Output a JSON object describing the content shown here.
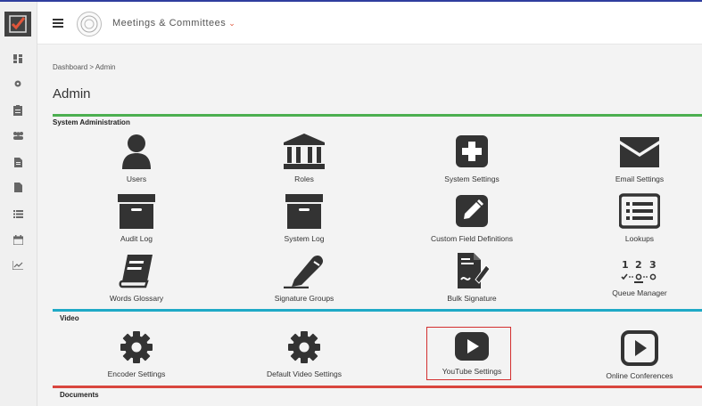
{
  "header": {
    "app_title": "Meetings & Committees",
    "title_chevron": "⌄"
  },
  "sidebar": {
    "items": [
      {
        "icon": "dashboard-icon"
      },
      {
        "icon": "gear-icon"
      },
      {
        "icon": "clipboard-icon"
      },
      {
        "icon": "users-icon"
      },
      {
        "icon": "document-icon"
      },
      {
        "icon": "file-icon"
      },
      {
        "icon": "list-icon"
      },
      {
        "icon": "calendar-icon"
      },
      {
        "icon": "chart-icon"
      }
    ]
  },
  "breadcrumb": {
    "root": "Dashboard",
    "separator": ">",
    "current": "Admin"
  },
  "page_title": "Admin",
  "sections": {
    "system": {
      "label": "System Administration",
      "color": "#4caf50",
      "tiles": [
        {
          "label": "Users",
          "icon": "user-icon"
        },
        {
          "label": "Roles",
          "icon": "institution-icon"
        },
        {
          "label": "System Settings",
          "icon": "plus-square-icon"
        },
        {
          "label": "Email Settings",
          "icon": "envelope-icon"
        },
        {
          "label": "Audit Log",
          "icon": "archive-icon"
        },
        {
          "label": "System Log",
          "icon": "archive-icon"
        },
        {
          "label": "Custom Field Definitions",
          "icon": "edit-square-icon"
        },
        {
          "label": "Lookups",
          "icon": "list-alt-icon"
        },
        {
          "label": "Words Glossary",
          "icon": "book-icon"
        },
        {
          "label": "Signature Groups",
          "icon": "pen-icon"
        },
        {
          "label": "Bulk Signature",
          "icon": "file-signature-icon"
        },
        {
          "label": "Queue Manager",
          "icon": "sort-numeric-icon"
        }
      ]
    },
    "video": {
      "label": "Video",
      "color": "#1ea9c6",
      "tiles": [
        {
          "label": "Encoder Settings",
          "icon": "gear-icon"
        },
        {
          "label": "Default Video Settings",
          "icon": "gear-icon"
        },
        {
          "label": "YouTube Settings",
          "icon": "youtube-icon"
        },
        {
          "label": "Online Conferences",
          "icon": "play-square-icon"
        }
      ]
    },
    "documents": {
      "label": "Documents",
      "color": "#d9463e"
    }
  },
  "colors": {
    "icon": "#333333",
    "highlight_border": "#d32f2f",
    "brand": "#e0553a",
    "top_accent": "#2f3e9e"
  }
}
